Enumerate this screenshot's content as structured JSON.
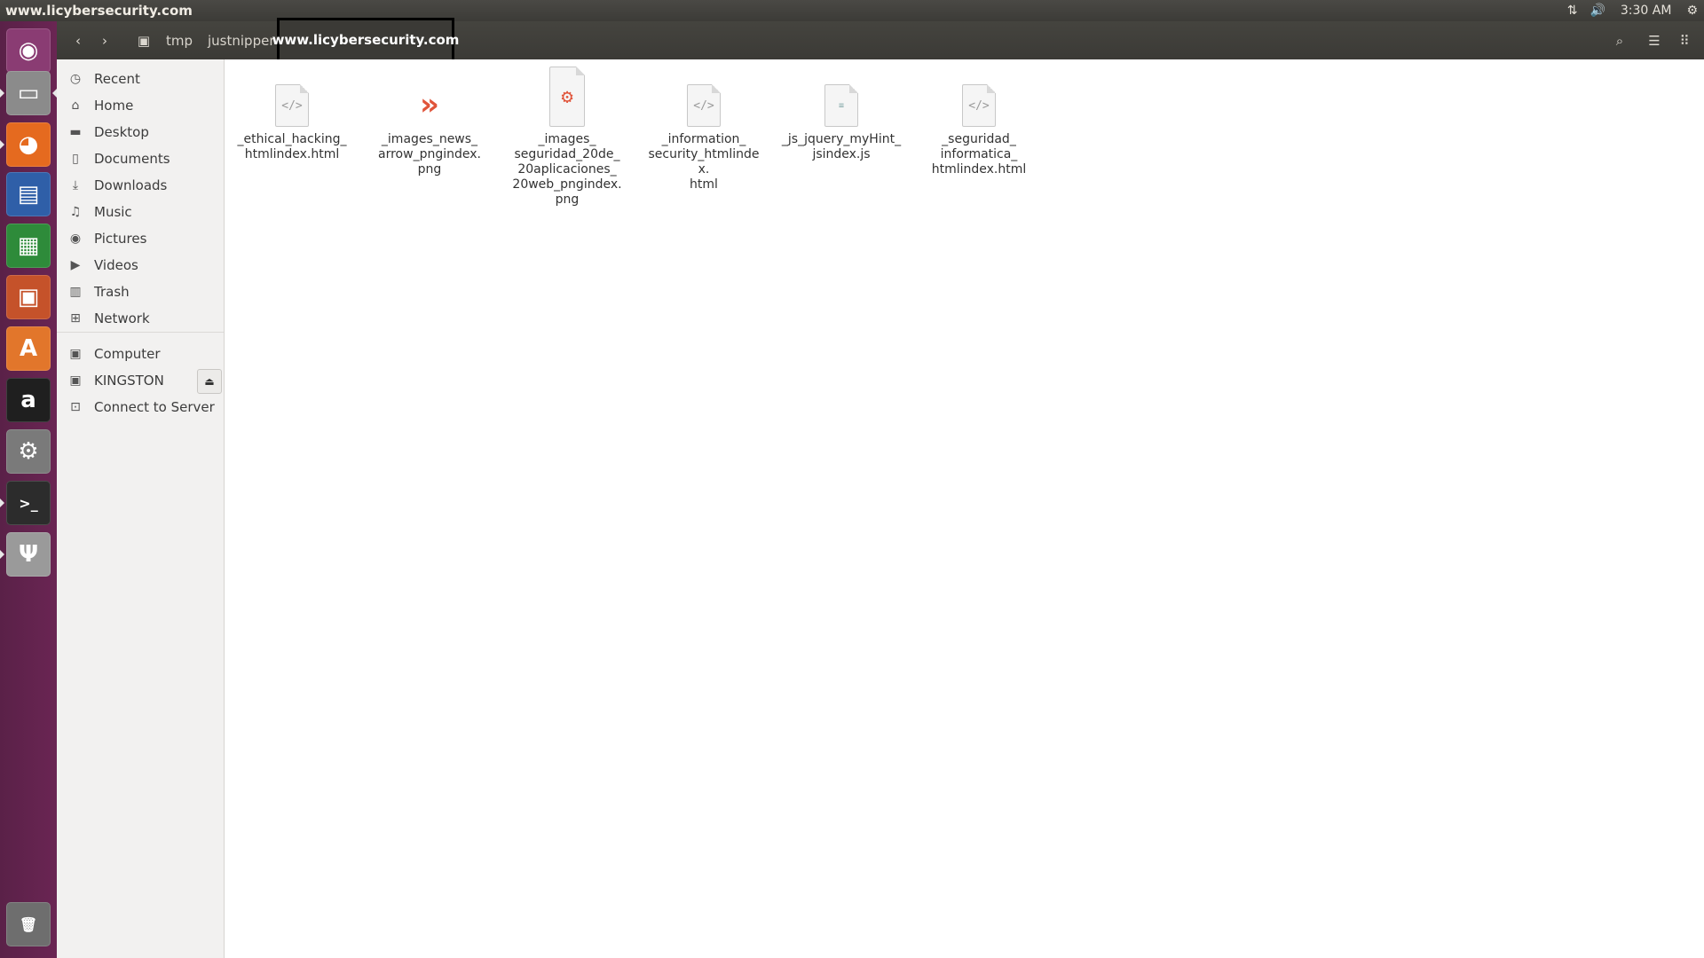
{
  "window": {
    "title": "www.licybersecurity.com"
  },
  "panel": {
    "clock": "3:30 AM"
  },
  "launcher": {
    "items": [
      {
        "name": "ubuntu-dash-icon",
        "label": "◉",
        "color": "#8a3c73",
        "pip": false,
        "pipr": false
      },
      {
        "name": "files-app-icon",
        "label": "▭",
        "color": "#8b8b8b",
        "pip": true,
        "pipr": true
      },
      {
        "name": "firefox-icon",
        "label": "◕",
        "color": "#e56a1f",
        "pip": true,
        "pipr": false
      },
      {
        "name": "libreoffice-writer-icon",
        "label": "▤",
        "color": "#2f5fa8",
        "pip": false,
        "pipr": false
      },
      {
        "name": "libreoffice-calc-icon",
        "label": "▦",
        "color": "#2e8b3a",
        "pip": false,
        "pipr": false
      },
      {
        "name": "libreoffice-impress-icon",
        "label": "▣",
        "color": "#c5522a",
        "pip": false,
        "pipr": false
      },
      {
        "name": "software-center-icon",
        "label": "A",
        "color": "#e2762b",
        "pip": false,
        "pipr": false
      },
      {
        "name": "amazon-icon",
        "label": "a",
        "color": "#1f1f1f",
        "pip": false,
        "pipr": false
      },
      {
        "name": "system-settings-icon",
        "label": "⚙",
        "color": "#7a7a7a",
        "pip": false,
        "pipr": false
      },
      {
        "name": "terminal-icon",
        "label": ">_",
        "color": "#2c2c2c",
        "pip": true,
        "pipr": false
      },
      {
        "name": "usb-drive-icon",
        "label": "Ψ",
        "color": "#9a9a9a",
        "pip": true,
        "pipr": false
      },
      {
        "name": "trash-launcher-icon",
        "label": "🗑",
        "color": "#6e6e6e",
        "pip": false,
        "pipr": false
      }
    ]
  },
  "breadcrumb": {
    "items": [
      "tmp",
      "justnipper"
    ],
    "current": "www.licybersecurity.com"
  },
  "sidebar": {
    "places": [
      {
        "name": "sidebar-item-recent",
        "icon": "◷",
        "label": "Recent"
      },
      {
        "name": "sidebar-item-home",
        "icon": "⌂",
        "label": "Home"
      },
      {
        "name": "sidebar-item-desktop",
        "icon": "▬",
        "label": "Desktop"
      },
      {
        "name": "sidebar-item-documents",
        "icon": "▯",
        "label": "Documents"
      },
      {
        "name": "sidebar-item-downloads",
        "icon": "⤓",
        "label": "Downloads"
      },
      {
        "name": "sidebar-item-music",
        "icon": "♫",
        "label": "Music"
      },
      {
        "name": "sidebar-item-pictures",
        "icon": "◉",
        "label": "Pictures"
      },
      {
        "name": "sidebar-item-videos",
        "icon": "▶",
        "label": "Videos"
      },
      {
        "name": "sidebar-item-trash",
        "icon": "▥",
        "label": "Trash"
      },
      {
        "name": "sidebar-item-network",
        "icon": "⊞",
        "label": "Network"
      }
    ],
    "devices": [
      {
        "name": "sidebar-item-computer",
        "icon": "▣",
        "label": "Computer"
      },
      {
        "name": "sidebar-item-kingston",
        "icon": "▣",
        "label": "KINGSTON"
      },
      {
        "name": "sidebar-item-connect-to-server",
        "icon": "⊡",
        "label": "Connect to Server"
      }
    ]
  },
  "files": [
    {
      "name": "_ethical_hacking_\nhtmlindex.html",
      "type": "html"
    },
    {
      "name": "_images_news_\narrow_pngindex.\npng",
      "type": "png-arrow"
    },
    {
      "name": "_images_\nseguridad_20de_\n20aplicaciones_\n20web_pngindex.\npng",
      "type": "png-app"
    },
    {
      "name": "_information_\nsecurity_htmlindex.\nhtml",
      "type": "html"
    },
    {
      "name": "_js_jquery_myHint_\njsindex.js",
      "type": "js"
    },
    {
      "name": "_seguridad_\ninformatica_\nhtmlindex.html",
      "type": "html"
    }
  ]
}
